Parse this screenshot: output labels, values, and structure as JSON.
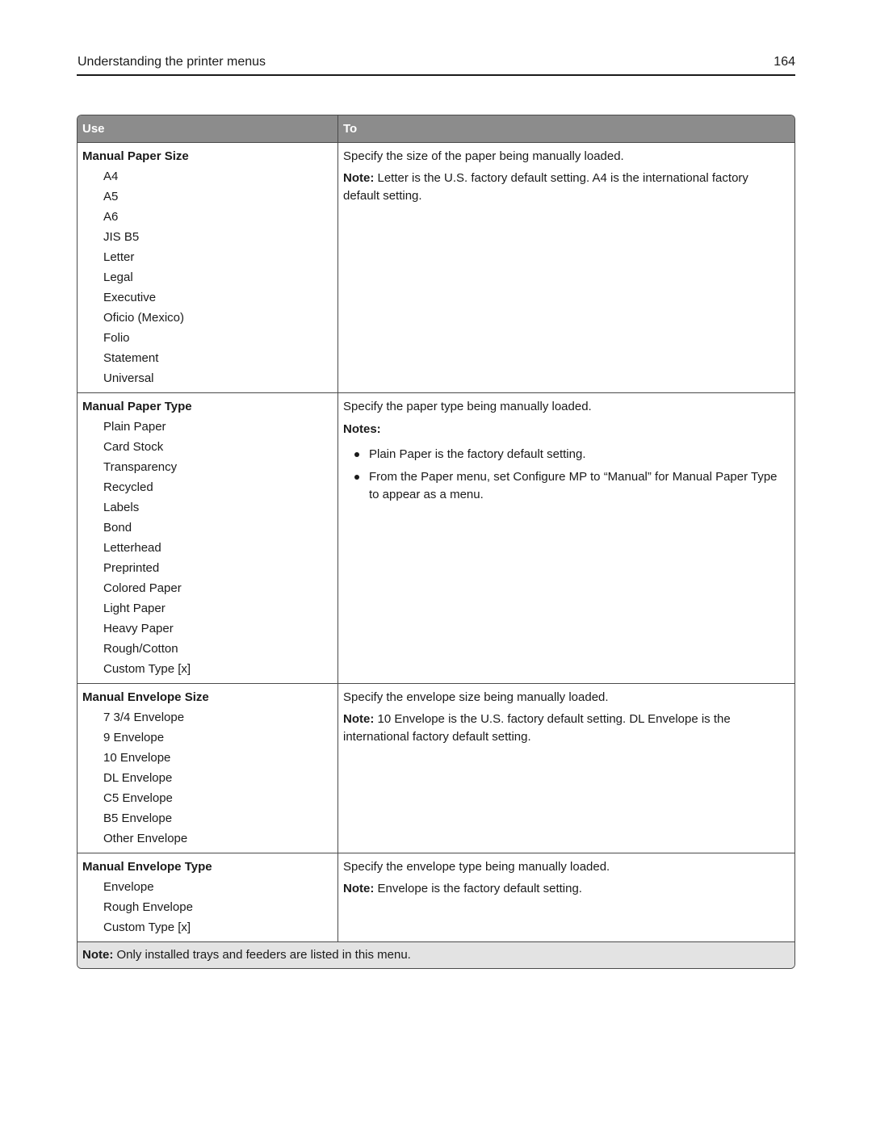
{
  "page_header": {
    "title": "Understanding the printer menus",
    "page_number": "164"
  },
  "table": {
    "columns": {
      "use": "Use",
      "to": "To"
    },
    "rows": [
      {
        "setting": "Manual Paper Size",
        "options": [
          "A4",
          "A5",
          "A6",
          "JIS B5",
          "Letter",
          "Legal",
          "Executive",
          "Oficio (Mexico)",
          "Folio",
          "Statement",
          "Universal"
        ],
        "description": "Specify the size of the paper being manually loaded.",
        "note_label": "Note:",
        "note_text": " Letter is the U.S. factory default setting. A4 is the international factory default setting."
      },
      {
        "setting": "Manual Paper Type",
        "options": [
          "Plain Paper",
          "Card Stock",
          "Transparency",
          "Recycled",
          "Labels",
          "Bond",
          "Letterhead",
          "Preprinted",
          "Colored Paper",
          "Light Paper",
          "Heavy Paper",
          "Rough/Cotton",
          "Custom Type [x]"
        ],
        "description": "Specify the paper type being manually loaded.",
        "notes_label": "Notes:",
        "notes": [
          "Plain Paper is the factory default setting.",
          "From the Paper menu, set Configure MP to “Manual” for Manual Paper Type to appear as a menu."
        ]
      },
      {
        "setting": "Manual Envelope Size",
        "options": [
          "7 3/4 Envelope",
          "9 Envelope",
          "10 Envelope",
          "DL Envelope",
          "C5 Envelope",
          "B5 Envelope",
          "Other Envelope"
        ],
        "description": "Specify the envelope size being manually loaded.",
        "note_label": "Note:",
        "note_text": " 10 Envelope is the U.S. factory default setting. DL Envelope is the international factory default setting."
      },
      {
        "setting": "Manual Envelope Type",
        "options": [
          "Envelope",
          "Rough Envelope",
          "Custom Type [x]"
        ],
        "description": "Specify the envelope type being manually loaded.",
        "note_label": "Note:",
        "note_text": " Envelope is the factory default setting."
      }
    ],
    "footer": {
      "note_label": "Note:",
      "note_text": " Only installed trays and feeders are listed in this menu."
    }
  },
  "colors": {
    "header_bg": "#8c8c8c",
    "footer_bg": "#e3e3e3",
    "border": "#4a4a4a"
  }
}
